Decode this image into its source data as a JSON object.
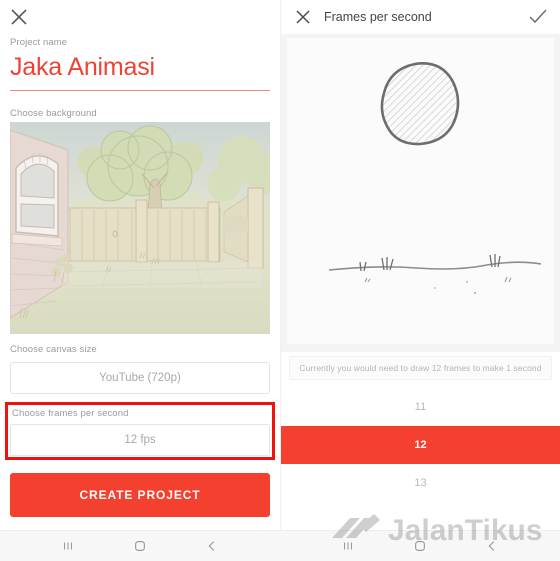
{
  "left_panel": {
    "close_icon": "close-icon",
    "project_name_label": "Project name",
    "project_name_value": "Jaka Animasi",
    "choose_background_label": "Choose background",
    "choose_canvas_size_label": "Choose canvas size",
    "canvas_size_value": "YouTube (720p)",
    "choose_fps_label": "Choose frames per second",
    "fps_value": "12 fps",
    "create_project_label": "CREATE PROJECT",
    "highlight_color": "#f2110d",
    "accent_color": "#f4412f"
  },
  "right_panel": {
    "close_icon": "close-icon",
    "title": "Frames per second",
    "confirm_icon": "check-icon",
    "info_text": "Currently you would need to draw 12 frames to make 1 second",
    "fps_options": [
      {
        "value": "11",
        "selected": false
      },
      {
        "value": "12",
        "selected": true
      },
      {
        "value": "13",
        "selected": false
      }
    ],
    "selected_color": "#f4412f"
  },
  "navbar": {
    "items": [
      {
        "icon": "recents-icon"
      },
      {
        "icon": "home-icon"
      },
      {
        "icon": "back-icon"
      }
    ]
  },
  "watermark": {
    "text": "JalanTikus"
  }
}
